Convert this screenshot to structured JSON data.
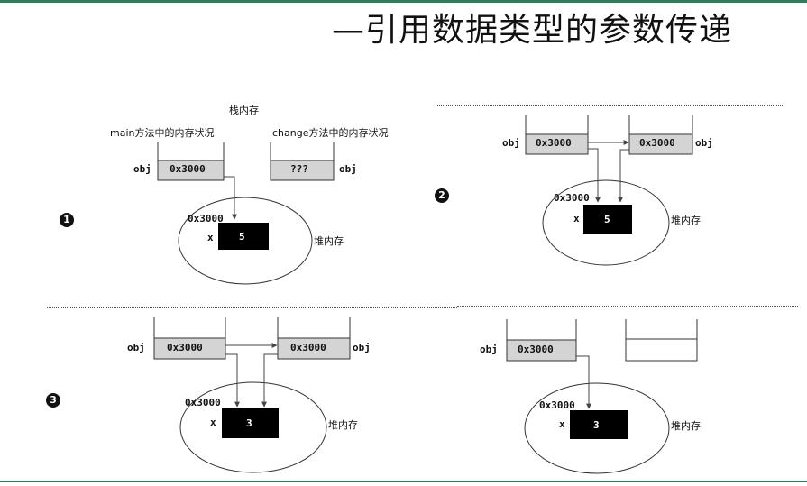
{
  "title": "—引用数据类型的参数传递",
  "panel1": {
    "step": "1",
    "stack_label": "栈内存",
    "main_label": "main方法中的内存状况",
    "change_label": "change方法中的内存状况",
    "left_var": "obj",
    "left_value": "0x3000",
    "right_value": "???",
    "right_var": "obj",
    "addr": "0x3000",
    "field": "x",
    "field_value": "5",
    "heap_label": "堆内存"
  },
  "panel2": {
    "step": "2",
    "left_var": "obj",
    "left_value": "0x3000",
    "right_value": "0x3000",
    "right_var": "obj",
    "addr": "0x3000",
    "field": "x",
    "field_value": "5",
    "heap_label": "堆内存"
  },
  "panel3": {
    "step": "3",
    "left_var": "obj",
    "left_value": "0x3000",
    "right_value": "0x3000",
    "right_var": "obj",
    "addr": "0x3000",
    "field": "x",
    "field_value": "3",
    "heap_label": "堆内存"
  },
  "panel4": {
    "left_var": "obj",
    "left_value": "0x3000",
    "addr": "0x3000",
    "field": "x",
    "field_value": "3",
    "heap_label": "堆内存"
  },
  "colors": {
    "rule": "#2e7d5b",
    "cell": "#d4d4d4",
    "object": "#000000"
  }
}
